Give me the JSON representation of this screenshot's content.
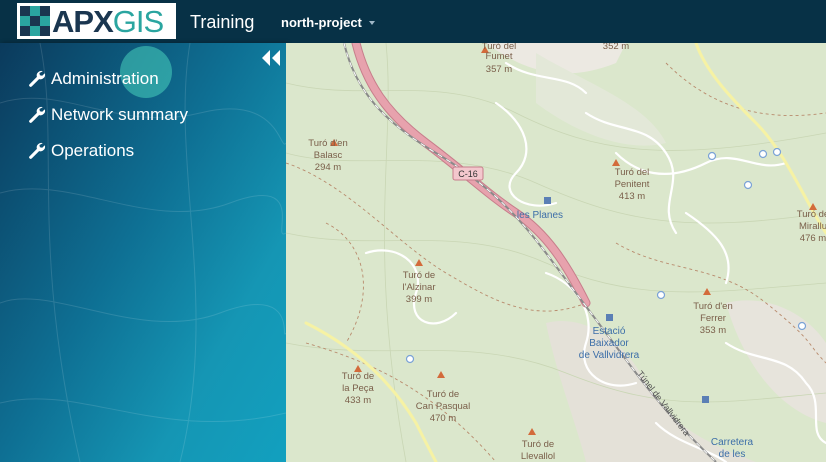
{
  "header": {
    "logo_text_a": "APX",
    "logo_text_b": "GIS",
    "app_title": "Training",
    "project": "north-project"
  },
  "sidebar": {
    "items": [
      {
        "label": "Administration",
        "icon": "wrench-icon"
      },
      {
        "label": "Network summary",
        "icon": "wrench-icon"
      },
      {
        "label": "Operations",
        "icon": "wrench-icon"
      }
    ]
  },
  "map": {
    "road_label": "C-16",
    "places": [
      {
        "name": "les Planes"
      },
      {
        "name": "Estació"
      },
      {
        "name": "Baixador"
      },
      {
        "name": "de Vallvidrera"
      },
      {
        "name": "Carretera"
      },
      {
        "name": "de les"
      }
    ],
    "peaks": [
      {
        "name": "Turó del",
        "elev": "352 m"
      },
      {
        "name": "Turó del",
        "sub": "Fumet",
        "elev": "357 m"
      },
      {
        "name": "Turó d'en",
        "sub": "Balasc",
        "elev": "294 m"
      },
      {
        "name": "Turó del",
        "sub": "Penitent",
        "elev": "413 m"
      },
      {
        "name": "Turó de",
        "sub": "Mirallu",
        "elev": "476 m"
      },
      {
        "name": "Turó de",
        "sub": "l'Alzinar",
        "elev": "399 m"
      },
      {
        "name": "Turó d'en",
        "sub": "Ferrer",
        "elev": "353 m"
      },
      {
        "name": "Turó de",
        "sub": "la Peça",
        "elev": "433 m"
      },
      {
        "name": "Turó de",
        "sub": "Can Pasqual",
        "elev": "470 m"
      },
      {
        "name": "Turó de",
        "sub": "Llevallol"
      }
    ],
    "tunnel_label": "Túnel de Vallvidrera"
  },
  "colors": {
    "topbar": "#073146",
    "sidebar_accent": "#1596b4",
    "logo_teal": "#2aa5a0",
    "road_pink": "#e7a2ad",
    "map_green": "#dbe7cc"
  }
}
